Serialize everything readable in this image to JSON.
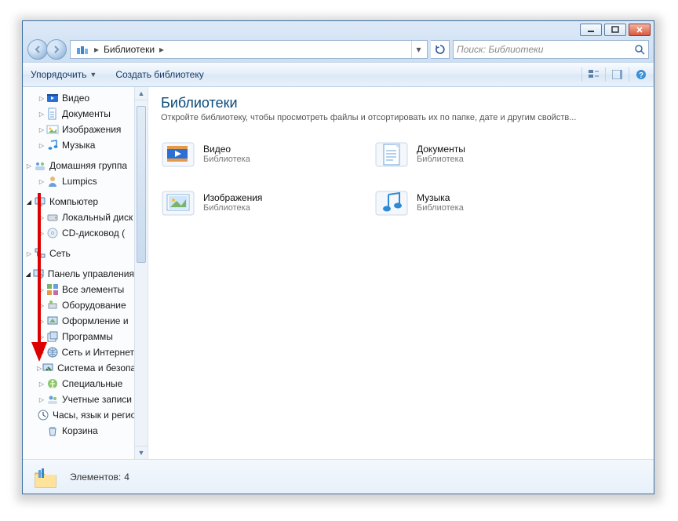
{
  "breadcrumb": {
    "root": "Библиотеки"
  },
  "search": {
    "placeholder": "Поиск: Библиотеки"
  },
  "toolbar": {
    "organize": "Упорядочить",
    "create_library": "Создать библиотеку"
  },
  "sidebar": {
    "items": [
      {
        "label": "Видео",
        "icon": "video",
        "depth": 2,
        "tw": "open"
      },
      {
        "label": "Документы",
        "icon": "doc",
        "depth": 2,
        "tw": "open"
      },
      {
        "label": "Изображения",
        "icon": "image",
        "depth": 2,
        "tw": "open"
      },
      {
        "label": "Музыка",
        "icon": "music",
        "depth": 2,
        "tw": "open"
      },
      {
        "label": "Домашняя группа",
        "icon": "homegroup",
        "depth": 1,
        "tw": "open"
      },
      {
        "label": "Lumpics",
        "icon": "user",
        "depth": 2,
        "tw": "open"
      },
      {
        "label": "Компьютер",
        "icon": "computer",
        "depth": 1,
        "tw": "filled"
      },
      {
        "label": "Локальный диск",
        "icon": "hdd",
        "depth": 2,
        "tw": "open"
      },
      {
        "label": "CD-дисковод (",
        "icon": "cd",
        "depth": 2,
        "tw": "open"
      },
      {
        "label": "Сеть",
        "icon": "network",
        "depth": 1,
        "tw": "open"
      },
      {
        "label": "Панель управления",
        "icon": "cpanel",
        "depth": 1,
        "tw": "filled"
      },
      {
        "label": "Все элементы",
        "icon": "cpanel-items",
        "depth": 2,
        "tw": "open"
      },
      {
        "label": "Оборудование",
        "icon": "hardware",
        "depth": 2,
        "tw": "open"
      },
      {
        "label": "Оформление и",
        "icon": "appearance",
        "depth": 2,
        "tw": "open"
      },
      {
        "label": "Программы",
        "icon": "programs",
        "depth": 2,
        "tw": "open"
      },
      {
        "label": "Сеть и Интернет",
        "icon": "net-internet",
        "depth": 2,
        "tw": "open"
      },
      {
        "label": "Система и безопасность",
        "icon": "system",
        "depth": 2,
        "tw": "open"
      },
      {
        "label": "Специальные",
        "icon": "access",
        "depth": 2,
        "tw": "open"
      },
      {
        "label": "Учетные записи",
        "icon": "accounts",
        "depth": 2,
        "tw": "open"
      },
      {
        "label": "Часы, язык и регион",
        "icon": "clock",
        "depth": 2,
        "tw": "none"
      },
      {
        "label": "Корзина",
        "icon": "recycle",
        "depth": 2,
        "tw": "none"
      }
    ]
  },
  "main": {
    "heading": "Библиотеки",
    "sub": "Откройте библиотеку, чтобы просмотреть файлы и отсортировать их по папке, дате и другим свойств...",
    "libs": [
      {
        "title": "Видео",
        "sub": "Библиотека",
        "icon": "video"
      },
      {
        "title": "Документы",
        "sub": "Библиотека",
        "icon": "doc"
      },
      {
        "title": "Изображения",
        "sub": "Библиотека",
        "icon": "image"
      },
      {
        "title": "Музыка",
        "sub": "Библиотека",
        "icon": "music"
      }
    ]
  },
  "status": {
    "label": "Элементов:",
    "count": "4"
  },
  "icons": {
    "video_colors": "#2a6fd6",
    "doc_colors": "#4a86c7",
    "image_colors": "#a9c8e8",
    "music_colors": "#2f8ad6"
  }
}
